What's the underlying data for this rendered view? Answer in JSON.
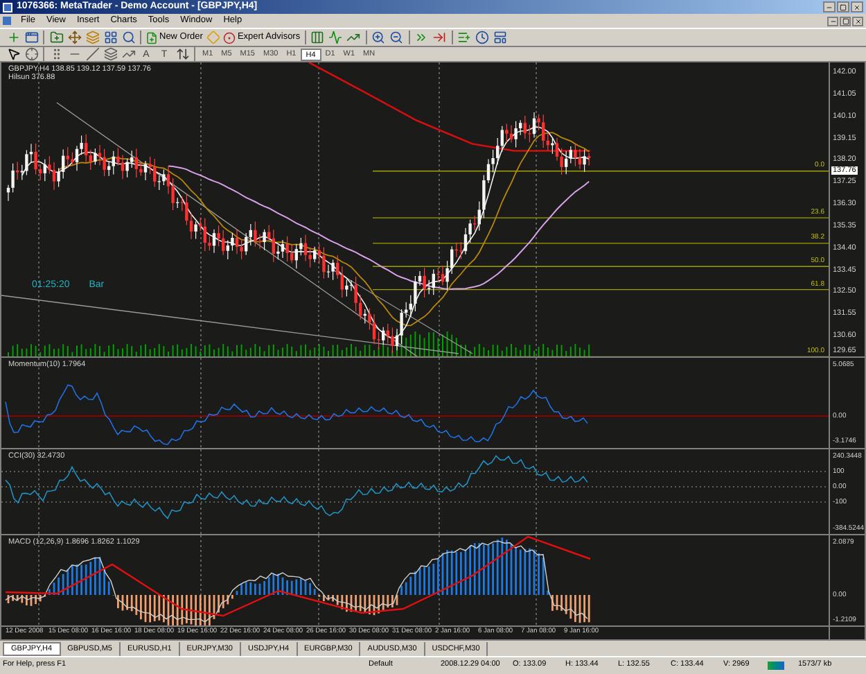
{
  "window": {
    "title": "1076366: MetaTrader - Demo Account - [GBPJPY,H4]"
  },
  "menu": [
    "File",
    "View",
    "Insert",
    "Charts",
    "Tools",
    "Window",
    "Help"
  ],
  "toolbar": {
    "new_order": "New Order",
    "expert_advisors": "Expert Advisors"
  },
  "drawing_tools": {
    "text_tools": [
      "A",
      "T"
    ]
  },
  "timeframes": [
    {
      "label": "M1",
      "selected": false
    },
    {
      "label": "M5",
      "selected": false
    },
    {
      "label": "M15",
      "selected": false
    },
    {
      "label": "M30",
      "selected": false
    },
    {
      "label": "H1",
      "selected": false
    },
    {
      "label": "H4",
      "selected": true
    },
    {
      "label": "D1",
      "selected": false
    },
    {
      "label": "W1",
      "selected": false
    },
    {
      "label": "MN",
      "selected": false
    }
  ],
  "chart": {
    "header": "GBPJPY,H4  138.85 139.12 137.59 137.76",
    "subheader": "Hilsun 376.88",
    "timer": "01:25:20",
    "timer_label": "Bar",
    "price_axis": [
      "142.00",
      "141.05",
      "140.10",
      "139.15",
      "138.20",
      "137.25",
      "136.30",
      "135.35",
      "134.40",
      "133.45",
      "132.50",
      "131.55",
      "130.60",
      "129.65"
    ],
    "current_price": "137.76",
    "fibonacci_levels": [
      "0.0",
      "23.6",
      "38.2",
      "50.0",
      "61.8",
      "100.0"
    ]
  },
  "indicators": [
    {
      "kind": "momentum",
      "label": "Momentum(10) 1.7964",
      "axis": [
        "5.0685",
        "0.00",
        "-3.1746"
      ]
    },
    {
      "kind": "cci",
      "label": "CCI(30) 32.4730",
      "axis": [
        "240.3448",
        "100",
        "0.00",
        "-100",
        "-384.5244"
      ]
    },
    {
      "kind": "macd",
      "label": "MACD (12,26,9) 1.8696 1.8262 1.1029",
      "axis": [
        "2.0879",
        "0.00",
        "-1.2109"
      ]
    }
  ],
  "time_axis": [
    "12 Dec 2008",
    "15 Dec 08:00",
    "16 Dec 16:00",
    "18 Dec 08:00",
    "19 Dec 16:00",
    "22 Dec 16:00",
    "24 Dec 08:00",
    "26 Dec 16:00",
    "30 Dec 08:00",
    "31 Dec 08:00",
    "2 Jan 16:00",
    "6 Jan 08:00",
    "7 Jan 08:00",
    "9 Jan 16:00"
  ],
  "tabs": [
    {
      "label": "GBPJPY,H4",
      "selected": true
    },
    {
      "label": "GBPUSD,M5",
      "selected": false
    },
    {
      "label": "EURUSD,H1",
      "selected": false
    },
    {
      "label": "EURJPY,M30",
      "selected": false
    },
    {
      "label": "USDJPY,H4",
      "selected": false
    },
    {
      "label": "EURGBP,M30",
      "selected": false
    },
    {
      "label": "AUDUSD,M30",
      "selected": false
    },
    {
      "label": "USDCHF,M30",
      "selected": false
    }
  ],
  "status_bar": {
    "help": "For Help, press F1",
    "profile": "Default",
    "time": "2008.12.29 04:00",
    "open": "O: 133.09",
    "high": "H: 133.44",
    "low": "L: 132.55",
    "close": "C: 133.44",
    "volume": "V: 2969",
    "traffic": "1573/7 kb"
  }
}
